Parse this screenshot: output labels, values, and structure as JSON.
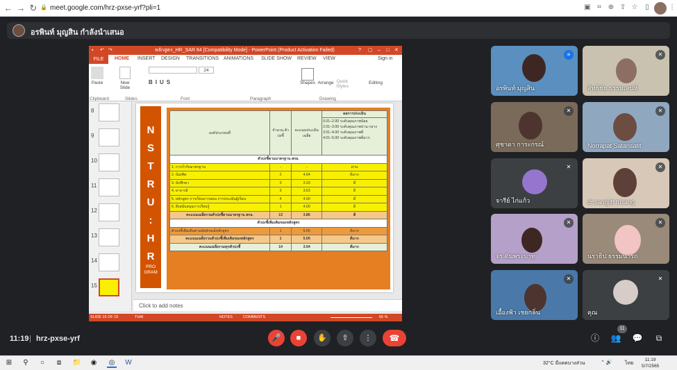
{
  "browser": {
    "url": "meet.google.com/hrz-pxse-yrf?pli=1"
  },
  "presenter": {
    "banner": "อรพินท์ มุญสิน กำลังนำเสนอ"
  },
  "ppt": {
    "title": "หลักสูตร_HR_SAR 64 [Compatibility Mode] - PowerPoint (Product Activation Failed)",
    "tabs": [
      "FILE",
      "HOME",
      "INSERT",
      "DESIGN",
      "TRANSITIONS",
      "ANIMATIONS",
      "SLIDE SHOW",
      "REVIEW",
      "VIEW"
    ],
    "signin": "Sign in",
    "groups": {
      "clipboard": "Clipboard",
      "slides": "Slides",
      "font": "Font",
      "paragraph": "Paragraph",
      "drawing": "Drawing"
    },
    "buttons": {
      "paste": "Paste",
      "new_slide": "New Slide",
      "shapes": "Shapes",
      "arrange": "Arrange",
      "quick_styles": "Quick Styles",
      "editing": "Editing",
      "font_size": "24"
    },
    "thumb_numbers": [
      "8",
      "9",
      "10",
      "11",
      "12",
      "13",
      "14",
      "15"
    ],
    "notes_placeholder": "Click to add notes",
    "status_left": "SLIDE 15 OF 15",
    "status_lang": "THAI",
    "status_notes": "NOTES",
    "status_comments": "COMMENTS",
    "zoom": "65 %"
  },
  "slide": {
    "letters": [
      "N",
      "S",
      "T",
      "R",
      "U",
      ":",
      "H",
      "R"
    ],
    "sub": [
      "PRO",
      "GRAM"
    ],
    "table": {
      "h_component": "องค์ประกอบที่",
      "h_count": "จำนวน ตัวบ่งชี้",
      "h_avg": "คะแนนประเมิน เฉลี่ย",
      "h_result": "ผลการประเมิน",
      "result_scale": [
        "0.01–2.00 ระดับคุณภาพน้อย",
        "2.01–3.00 ระดับคุณภาพปาน กลาง",
        "3.01–4.00 ระดับคุณภาพดี",
        "4.01–5.00 ระดับคุณภาพดีมาก"
      ],
      "section1": "ตัวบ่งชี้ตามมาตรฐาน สกอ.",
      "rows": [
        {
          "name": "1. การกำกับมาตรฐาน",
          "count": "-",
          "avg": "-",
          "result": "ผ่าน"
        },
        {
          "name": "2. บัณฑิต",
          "count": "2",
          "avg": "4.64",
          "result": "ดีมาก"
        },
        {
          "name": "3. นักศึกษา",
          "count": "3",
          "avg": "3.33",
          "result": "ดี"
        },
        {
          "name": "4. อาจารย์",
          "count": "3",
          "avg": "3.63",
          "result": "ดี"
        },
        {
          "name": "5. หลักสูตร การเรียนการสอน การประเมินผู้เรียน",
          "count": "4",
          "avg": "4.00",
          "result": "ดี"
        },
        {
          "name": "6. สิ่งสนับสนุนการเรียนรู้",
          "count": "1",
          "avg": "4.00",
          "result": "ดี"
        }
      ],
      "sum1": {
        "name": "คะแนนเฉลี่ยรวมตัวบ่งชี้ตามมาตรฐาน สกอ.",
        "count": "13",
        "avg": "3.86",
        "result": "ดี"
      },
      "section2": "ตัวบ่งชี้เพิ่มเติมของหลักสูตร",
      "extra": {
        "name": "ตัวบ่งชี้เพิ่มเติมตามอัตลักษณ์หลักสูตร",
        "count": "1",
        "avg": "5.00",
        "result": "ดีมาก"
      },
      "sum2": {
        "name": "คะแนนเฉลี่ยรวมตัวบ่งชี้เพิ่มเติมของหลักสูตร",
        "count": "1",
        "avg": "5.00",
        "result": "ดีมาก"
      },
      "total": {
        "name": "คะแนนเฉลี่ยรวมทุกตัวบ่งชี้",
        "count": "14",
        "avg": "3.94",
        "result": "ดีมาก"
      }
    }
  },
  "participants": [
    "อรพินท์ มุญสิน",
    "สิทธิชัย ธรรมเสน่ห์",
    "ศุชาดา การะกรณ์",
    "Norrapat Satansatit",
    "จารีย์ ไก่แก้ว",
    "dr.sangjitt trisang",
    "จร ตันพระบาท",
    "นราธิป ธรรมนารถ",
    "เอื้องฟ้า เชยกลิ่น",
    "คุณ"
  ],
  "footer": {
    "time": "11:19",
    "separator": "|",
    "code": "hrz-pxse-yrf",
    "people_count": "11"
  },
  "taskbar": {
    "weather": "32°C  มีแดดบางส่วน",
    "lang": "ไทย",
    "clock_time": "11:19",
    "clock_date": "5/7/2565"
  },
  "colors": {
    "ppt_orange": "#d24726",
    "meet_red": "#ea4335",
    "meet_bg": "#202124"
  }
}
